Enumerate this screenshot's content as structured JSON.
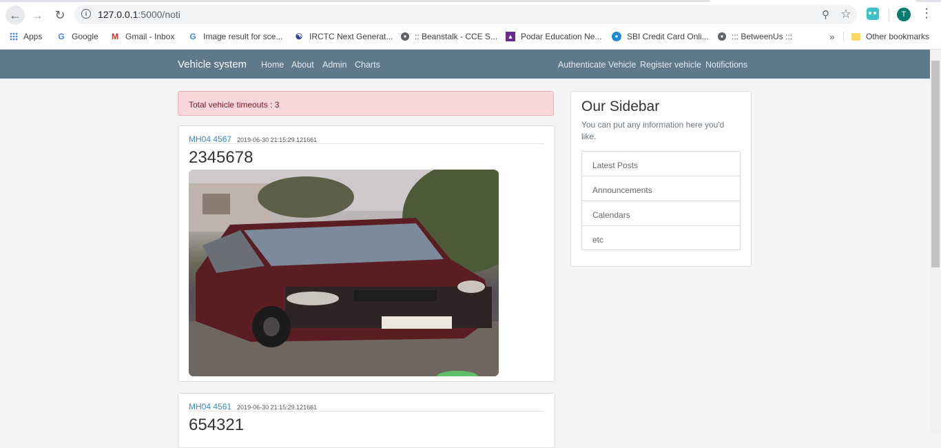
{
  "browser": {
    "url_host": "127.0.0.1",
    "url_rest": ":5000/noti",
    "avatar_letter": "T"
  },
  "bookmarks": [
    {
      "label": "Apps",
      "icon": "apps-grid-icon"
    },
    {
      "label": "Google",
      "icon": "google-icon"
    },
    {
      "label": "Gmail - Inbox",
      "icon": "gmail-icon"
    },
    {
      "label": "Image result for sce...",
      "icon": "google-icon"
    },
    {
      "label": "IRCTC Next Generat...",
      "icon": "irctc-icon"
    },
    {
      "label": ":: Beanstalk - CCE S...",
      "icon": "globe-icon"
    },
    {
      "label": "Podar Education Ne...",
      "icon": "podar-icon"
    },
    {
      "label": "SBI Credit Card Onli...",
      "icon": "sbi-icon"
    },
    {
      "label": "::: BetweenUs :::",
      "icon": "globe-icon"
    }
  ],
  "other_bookmarks": "Other bookmarks",
  "navbar": {
    "brand": "Vehicle system",
    "left_links": [
      "Home",
      "About",
      "Admin",
      "Charts"
    ],
    "right_links": [
      "Authenticate Vehicle",
      "Register vehicle",
      "Notifictions"
    ]
  },
  "alert": "Total vehicle timeouts : 3",
  "posts": [
    {
      "plate": "MH04 4567",
      "time": "2019-06-30 21:15:29.121661",
      "title": "2345678"
    },
    {
      "plate": "MH04 4561",
      "time": "2019-06-30 21:15:29.121661",
      "title": "654321"
    }
  ],
  "sidebar": {
    "title": "Our Sidebar",
    "text": "You can put any information here you'd like.",
    "items": [
      "Latest Posts",
      "Announcements",
      "Calendars",
      "etc"
    ]
  },
  "colors": {
    "navbar": "#5f788a",
    "alert_bg": "#f8d7da",
    "link": "#3b87c6"
  }
}
